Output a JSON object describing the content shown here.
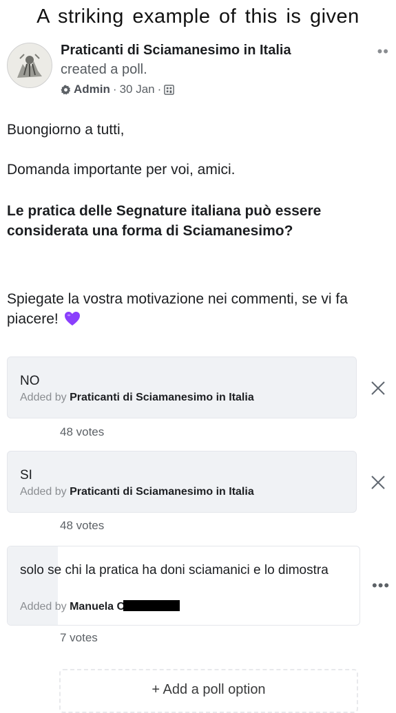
{
  "caption": "A striking example of this is given",
  "post": {
    "author": "Praticanti di Sciamanesimo in Italia",
    "action": "created a poll.",
    "role": "Admin",
    "date": "30 Jan",
    "separator": "·",
    "more_label": "••",
    "greeting": "Buongiorno a tutti,",
    "intro": "Domanda importante per voi, amici.",
    "question": "Le pratica delle Segnature italiana può essere considerata una forma di Sciamanesimo?",
    "closing": "Spiegate la vostra motivazione nei commenti, se vi fa piacere!"
  },
  "poll": {
    "added_by_label": "Added by",
    "options": [
      {
        "label": "NO",
        "added_by": "Praticanti di Sciamanesimo in Italia",
        "votes": "48 votes",
        "action_icon": "close-icon"
      },
      {
        "label": "SI",
        "added_by": "Praticanti di Sciamanesimo in Italia",
        "votes": "48 votes",
        "action_icon": "close-icon"
      },
      {
        "label": "solo se chi la pratica ha doni sciamanici e lo dimostra",
        "added_by": "Manuela C",
        "votes": "7 votes",
        "action_icon": "more-dots-icon"
      }
    ],
    "more_label": "•••",
    "add_option": "+ Add a poll option"
  },
  "colors": {
    "heart": "#8a3ffc",
    "option_bg": "#f0f2f5",
    "muted": "#8a8d91"
  }
}
